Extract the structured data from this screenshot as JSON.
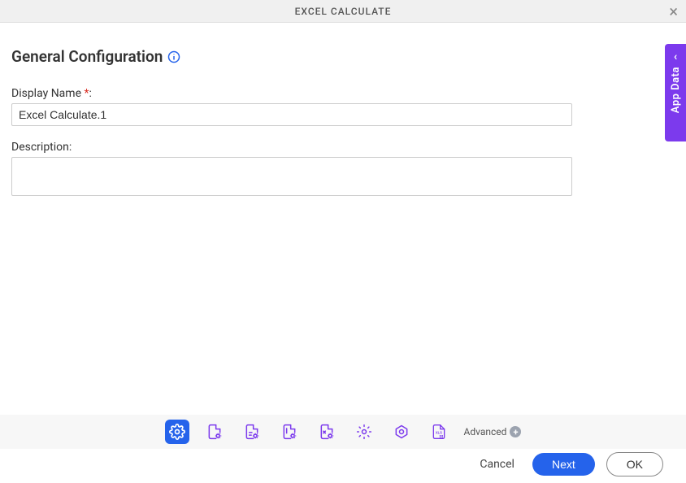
{
  "modal": {
    "title": "EXCEL CALCULATE"
  },
  "section": {
    "title": "General Configuration"
  },
  "fields": {
    "displayName": {
      "label": "Display Name",
      "value": "Excel Calculate.1",
      "required": "*",
      "colon": ":"
    },
    "description": {
      "label": "Description:",
      "value": ""
    }
  },
  "sideTab": {
    "label": "App Data"
  },
  "toolbar": {
    "advanced_label": "Advanced"
  },
  "buttons": {
    "cancel": "Cancel",
    "next": "Next",
    "ok": "OK"
  }
}
